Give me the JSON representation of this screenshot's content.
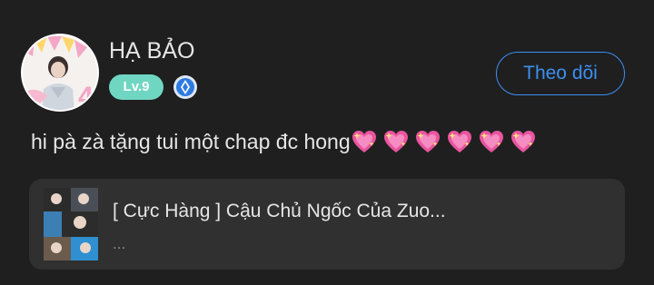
{
  "user": {
    "name": "HẠ BẢO",
    "level": "Lv.9",
    "avatar_icon": "birthday-avatar",
    "verified_icon": "shield-badge-icon"
  },
  "follow_button": {
    "label": "Theo dõi"
  },
  "comment": {
    "text": "hi pà zà tặng tui một chap đc hong",
    "emoji_icon": "sparkling-heart-icon",
    "emoji_count": 6
  },
  "link_card": {
    "title": "[ Cực Hàng ] Cậu Chủ Ngốc Của Zuo...",
    "subtitle": "..."
  },
  "colors": {
    "background": "#1f1f20",
    "accent": "#3d8ff0",
    "level_badge": "#6fd6c2",
    "card_background": "#303031",
    "text": "#e6e6e6"
  }
}
